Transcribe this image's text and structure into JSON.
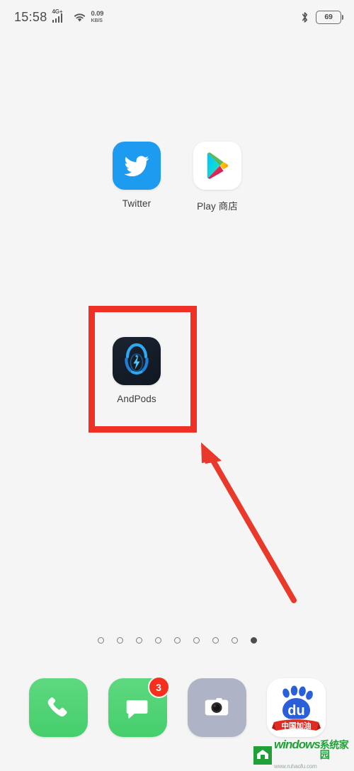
{
  "status_bar": {
    "time": "15:58",
    "network_type": "4G+",
    "signal_icon": "signal-bars-icon",
    "wifi_icon": "wifi-icon",
    "net_speed_value": "0.09",
    "net_speed_unit": "KB/S",
    "bluetooth_icon": "bluetooth-icon",
    "battery_level": "69"
  },
  "home_screen": {
    "row1": [
      {
        "label": "Twitter",
        "icon": "twitter-icon"
      },
      {
        "label": "Play 商店",
        "icon": "google-play-icon"
      }
    ],
    "row2": [
      {
        "label": "AndPods",
        "icon": "andpods-icon"
      }
    ],
    "highlight": {
      "color": "#ee3124",
      "target": "AndPods"
    },
    "arrow": {
      "color": "#e8392b",
      "points_to": "AndPods"
    },
    "page_indicator": {
      "total": 9,
      "active_index": 8
    }
  },
  "dock": {
    "items": [
      {
        "label": "Phone",
        "icon": "phone-icon",
        "badge": ""
      },
      {
        "label": "Messages",
        "icon": "message-icon",
        "badge": "3"
      },
      {
        "label": "Camera",
        "icon": "camera-icon",
        "badge": ""
      },
      {
        "label": "Baidu",
        "icon": "baidu-icon",
        "badge": ""
      }
    ]
  },
  "baidu_icon": {
    "word": "du",
    "banner_text": "中国加油"
  },
  "watermark": {
    "name_en": "windows",
    "name_cn": "系统家园",
    "url": "www.ruhaofu.com"
  },
  "colors": {
    "background": "#f5f5f5",
    "accent_red": "#ee3124",
    "twitter_blue": "#1d9bf0",
    "green": "#46ce6c",
    "baidu_blue": "#2b5fd9"
  }
}
